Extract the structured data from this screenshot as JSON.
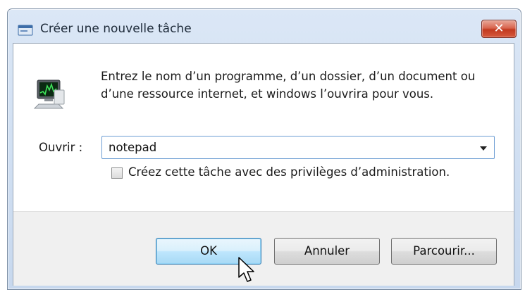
{
  "window": {
    "title": "Créer une nouvelle tâche",
    "close_glyph": "✕"
  },
  "dialog": {
    "description": "Entrez le nom d’un programme, d’un dossier, d’un document ou d’une ressource internet, et windows l’ouvrira pour vous.",
    "open_label": "Ouvrir :",
    "open_value": "notepad",
    "admin_checkbox_label": "Créez cette tâche avec des privilèges d’administration.",
    "admin_checked": false
  },
  "buttons": {
    "ok": "OK",
    "cancel": "Annuler",
    "browse": "Parcourir..."
  },
  "icons": {
    "title": "run-dialog-icon",
    "app": "task-manager-monitor-icon",
    "dropdown": "chevron-down-icon",
    "cursor": "mouse-pointer-icon"
  },
  "colors": {
    "titlebar": "#c7d8ee",
    "close_button": "#c2391f",
    "ok_button": "#bee6fd",
    "footer": "#f0f0f0"
  }
}
